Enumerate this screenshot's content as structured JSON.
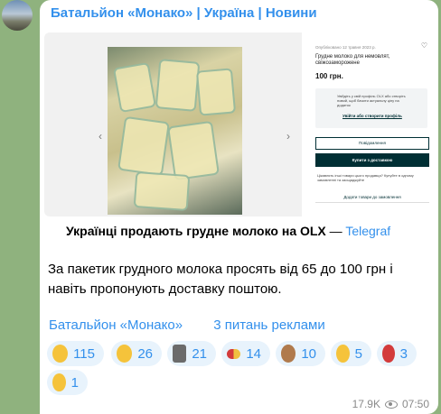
{
  "channel": {
    "name": "Батальйон «Монако» | Україна | Новини"
  },
  "preview": {
    "olx": {
      "date": "Опубліковано 12 травня 2023 р.",
      "title": "Грудне молоко для немовлят, свіжозаморожене",
      "price": "100 грн.",
      "info_text": "Увійдіть у свій профіль OLX або створіть новий, щоб бачити актуальну ціну на додаток",
      "info_link": "Увійти або створити профіль",
      "btn_message": "Повідомлення",
      "btn_buy": "Купити з доставкою",
      "small_text": "Цікавлять інші товари цього продавця? Купуйте в одному замовленні та заощаджуйте",
      "btn_add": "Додати товари до замовлення"
    }
  },
  "post": {
    "headline_bold": "Українці продають грудне молоко на OLX",
    "headline_sep": " — ",
    "headline_source": "Telegraf",
    "body": "За пакетик грудного молока просять від 65 до 100 грн і навіть пропонують доставку поштою."
  },
  "footer": {
    "link1": "Батальйон «Монако»",
    "link2": "3 питань реклами"
  },
  "reactions": [
    {
      "emoji": "smirking-face",
      "count": "115",
      "color": "#f5c33b"
    },
    {
      "emoji": "screaming-face",
      "count": "26",
      "color": "#f5c33b"
    },
    {
      "emoji": "moai",
      "count": "21",
      "color": "#6b6b6b"
    },
    {
      "emoji": "pill",
      "count": "14",
      "color": "#e7b43a"
    },
    {
      "emoji": "see-no-evil-monkey",
      "count": "10",
      "color": "#b07a4c"
    },
    {
      "emoji": "smiling-face-with-hearts",
      "count": "5",
      "color": "#f5c33b"
    },
    {
      "emoji": "broken-heart",
      "count": "3",
      "color": "#d33b3b"
    },
    {
      "emoji": "thumbs-up",
      "count": "1",
      "color": "#f5c33b"
    }
  ],
  "meta": {
    "views": "17.9K",
    "time": "07:50"
  }
}
